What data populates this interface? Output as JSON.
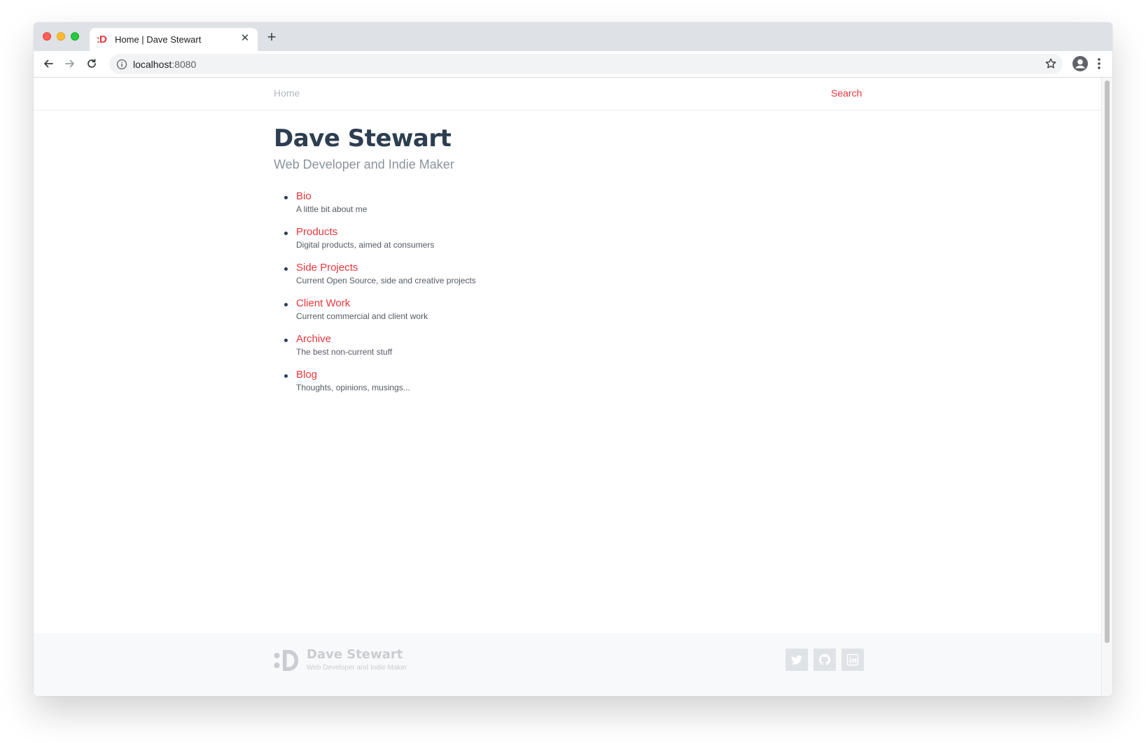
{
  "browser": {
    "tab_title": "Home | Dave Stewart",
    "favicon_text": ":D",
    "url_host": "localhost",
    "url_port": ":8080"
  },
  "nav": {
    "home_label": "Home",
    "search_label": "Search"
  },
  "hero": {
    "title": "Dave Stewart",
    "subtitle": "Web Developer and Indie Maker"
  },
  "sections": [
    {
      "label": "Bio",
      "description": "A little bit about me"
    },
    {
      "label": "Products",
      "description": "Digital products, aimed at consumers"
    },
    {
      "label": "Side Projects",
      "description": "Current Open Source, side and creative projects"
    },
    {
      "label": "Client Work",
      "description": "Current commercial and client work"
    },
    {
      "label": "Archive",
      "description": "The best non-current stuff"
    },
    {
      "label": "Blog",
      "description": "Thoughts, opinions, musings..."
    }
  ],
  "footer": {
    "name": "Dave Stewart",
    "tagline": "Web Developer and Indie Maker",
    "social_icons": [
      "twitter-icon",
      "github-icon",
      "linkedin-icon"
    ]
  },
  "colors": {
    "accent": "#e8363b",
    "heading": "#2c3e50",
    "muted": "#8b939c"
  }
}
